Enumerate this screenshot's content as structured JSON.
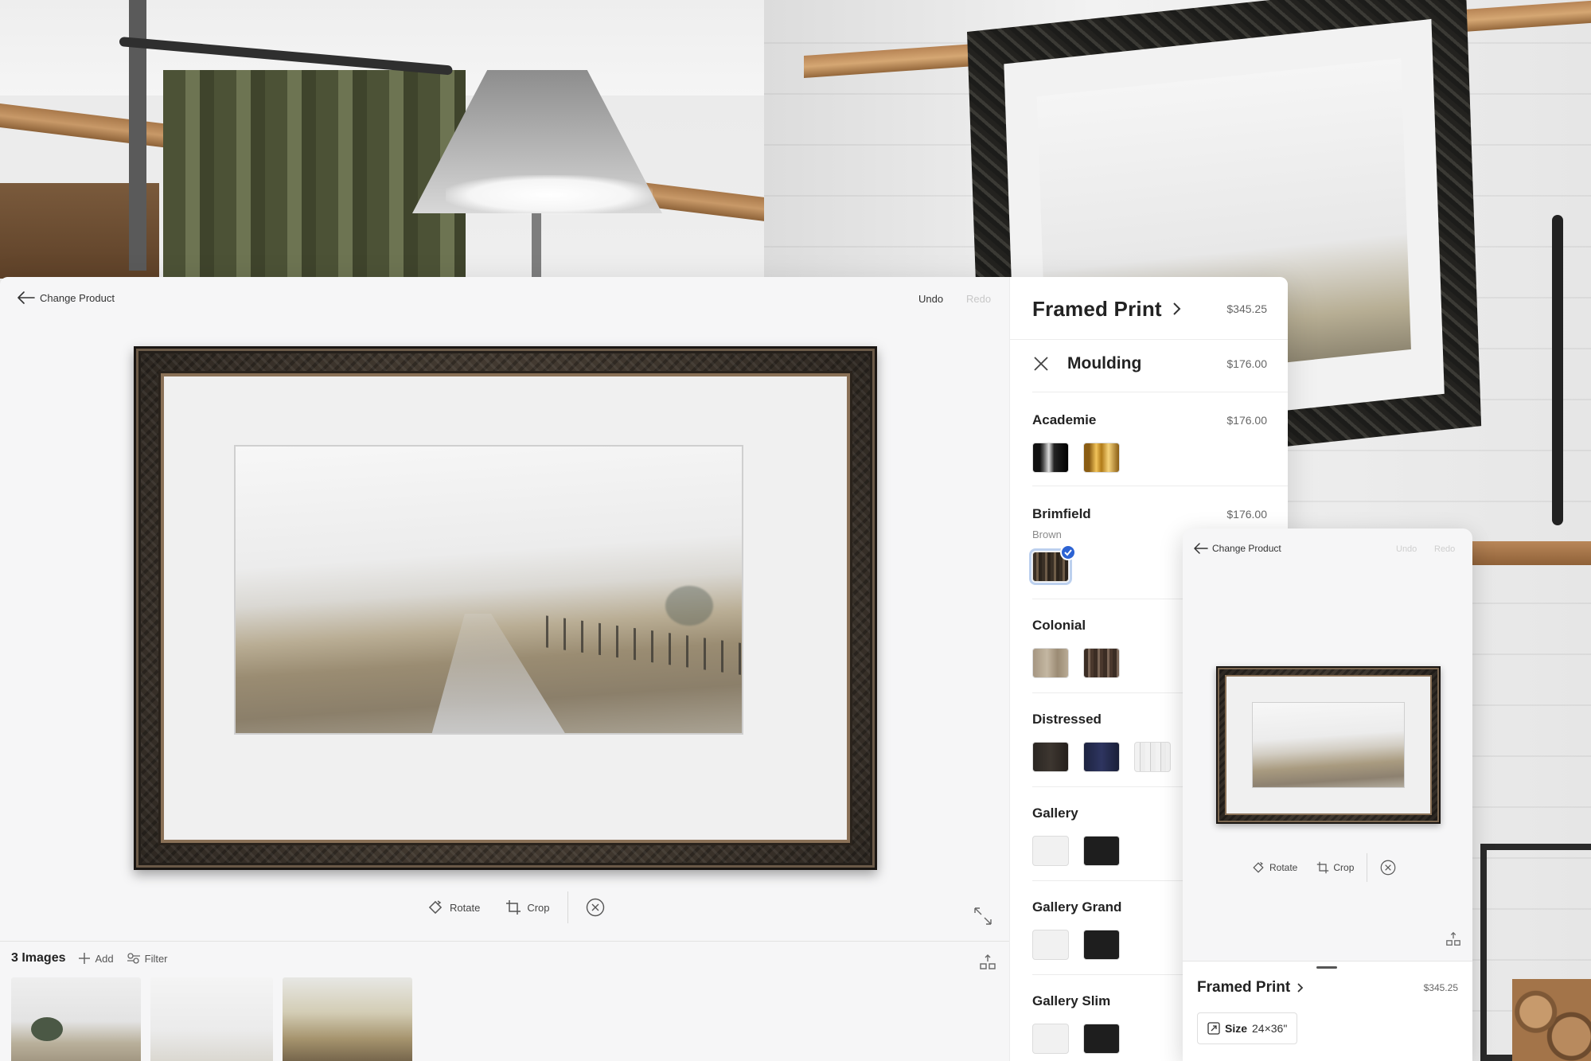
{
  "editor": {
    "back_label": "Change Product",
    "undo_label": "Undo",
    "redo_label": "Redo",
    "tools": {
      "rotate_label": "Rotate",
      "crop_label": "Crop"
    },
    "images": {
      "count_label": "3 Images",
      "add_label": "Add",
      "filter_label": "Filter"
    }
  },
  "panel": {
    "product_title": "Framed Print",
    "product_price": "$345.25",
    "section_title": "Moulding",
    "section_price": "$176.00",
    "groups": [
      {
        "name": "Academie",
        "price": "$176.00",
        "subtitle": ""
      },
      {
        "name": "Brimfield",
        "price": "$176.00",
        "subtitle": "Brown"
      },
      {
        "name": "Colonial",
        "price": "",
        "subtitle": ""
      },
      {
        "name": "Distressed",
        "price": "",
        "subtitle": ""
      },
      {
        "name": "Gallery",
        "price": "",
        "subtitle": ""
      },
      {
        "name": "Gallery Grand",
        "price": "",
        "subtitle": ""
      },
      {
        "name": "Gallery Slim",
        "price": "",
        "subtitle": ""
      }
    ],
    "selected_swatch": "Brimfield Brown"
  },
  "mobile": {
    "back_label": "Change Product",
    "undo_label": "Undo",
    "redo_label": "Redo",
    "rotate_label": "Rotate",
    "crop_label": "Crop",
    "product_title": "Framed Print",
    "product_price": "$345.25",
    "size_label": "Size",
    "size_value": "24×36\""
  },
  "colors": {
    "accent": "#2d63d3",
    "panel_bg": "#ffffff",
    "canvas_bg": "#f6f6f7"
  }
}
